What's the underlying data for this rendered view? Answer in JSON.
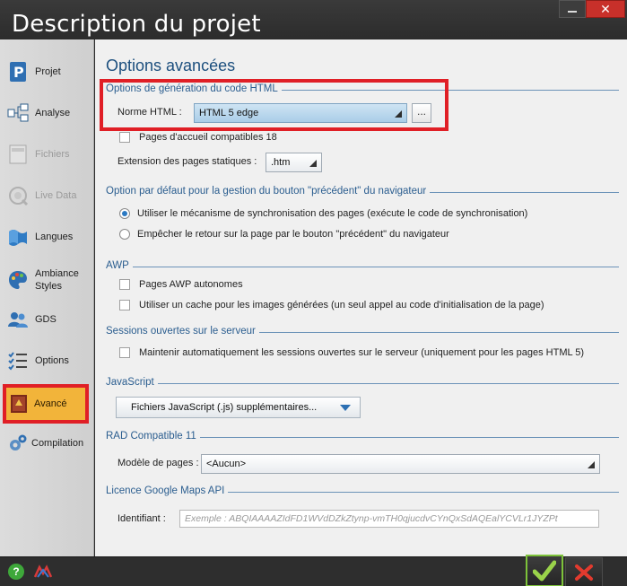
{
  "window": {
    "title": "Description du projet"
  },
  "sidebar": {
    "items": [
      {
        "label": "Projet",
        "icon": "project-p-icon",
        "state": "normal"
      },
      {
        "label": "Analyse",
        "icon": "analysis-icon",
        "state": "normal"
      },
      {
        "label": "Fichiers",
        "icon": "files-icon",
        "state": "disabled"
      },
      {
        "label": "Live Data",
        "icon": "live-data-icon",
        "state": "disabled"
      },
      {
        "label": "Langues",
        "icon": "languages-icon",
        "state": "normal"
      },
      {
        "label": "Ambiance Styles",
        "icon": "styles-icon",
        "state": "normal"
      },
      {
        "label": "GDS",
        "icon": "gds-icon",
        "state": "normal"
      },
      {
        "label": "Options",
        "icon": "options-list-icon",
        "state": "normal"
      },
      {
        "label": "Avancé",
        "icon": "advanced-book-icon",
        "state": "active"
      },
      {
        "label": "Compilation",
        "icon": "gears-icon",
        "state": "normal"
      }
    ]
  },
  "main": {
    "heading": "Options avancées",
    "html_gen": {
      "title": "Options de génération du code HTML",
      "norm_label": "Norme HTML :",
      "norm_value": "HTML 5 edge",
      "ellipsis": "...",
      "home_compat_label": "Pages d'accueil compatibles 18",
      "static_ext_label": "Extension des pages statiques :",
      "static_ext_value": ".htm"
    },
    "back_button": {
      "title": "Option par défaut pour la gestion du bouton \"précédent\" du navigateur",
      "option1": "Utiliser le mécanisme de synchronisation des pages (exécute le code de synchronisation)",
      "option2": "Empêcher le retour sur la page par le bouton \"précédent\" du navigateur",
      "selected": 1
    },
    "awp": {
      "title": "AWP",
      "option1": "Pages AWP autonomes",
      "option2": "Utiliser un cache pour les images générées (un seul appel au code d'initialisation de la page)"
    },
    "sessions": {
      "title": "Sessions ouvertes sur le serveur",
      "option1": "Maintenir automatiquement les sessions ouvertes sur le serveur (uniquement pour les pages HTML 5)"
    },
    "javascript": {
      "title": "JavaScript",
      "button": "Fichiers JavaScript (.js) supplémentaires..."
    },
    "rad": {
      "title": "RAD Compatible 11",
      "model_label": "Modèle de pages :",
      "model_value": "<Aucun>"
    },
    "gmaps": {
      "title": "Licence Google Maps API",
      "id_label": "Identifiant :",
      "id_placeholder": "Exemple : ABQIAAAAZIdFD1WVdDZkZtynp-vmTH0qjucdvCYnQxSdAQEalYCVLr1JYZPt"
    }
  },
  "footer": {
    "help": "?"
  },
  "colors": {
    "accent_active": "#f2b43a",
    "highlight": "#e01f26",
    "section_title": "#2a5d8f",
    "ok_border": "#7dc23a",
    "cancel_x": "#e23a2e"
  }
}
